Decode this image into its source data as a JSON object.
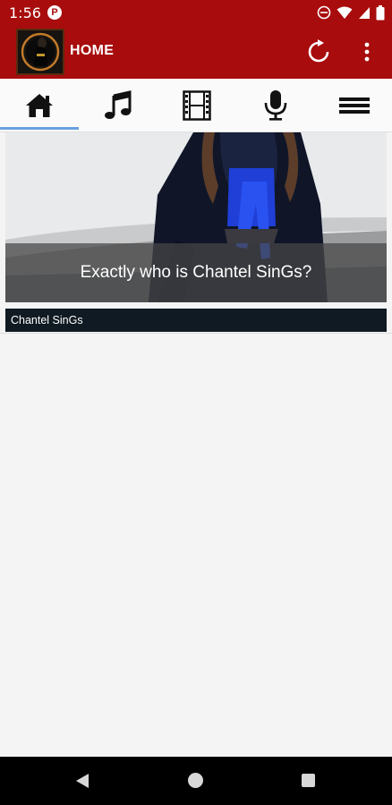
{
  "status": {
    "time": "1:56",
    "app_icon": "P"
  },
  "app_bar": {
    "title": "HOME"
  },
  "tabs": [
    {
      "name": "home",
      "icon": "home-icon",
      "active": true
    },
    {
      "name": "music",
      "icon": "music-note-icon",
      "active": false
    },
    {
      "name": "video",
      "icon": "film-strip-icon",
      "active": false
    },
    {
      "name": "podcast",
      "icon": "microphone-icon",
      "active": false
    },
    {
      "name": "menu",
      "icon": "hamburger-menu-icon",
      "active": false
    }
  ],
  "feature": {
    "caption": "Exactly who is Chantel SinGs?",
    "source": "Chantel SinGs"
  },
  "colors": {
    "brand": "#a80c0c",
    "tab_indicator": "#6aa0e0",
    "source_bar": "#0f1a22"
  }
}
